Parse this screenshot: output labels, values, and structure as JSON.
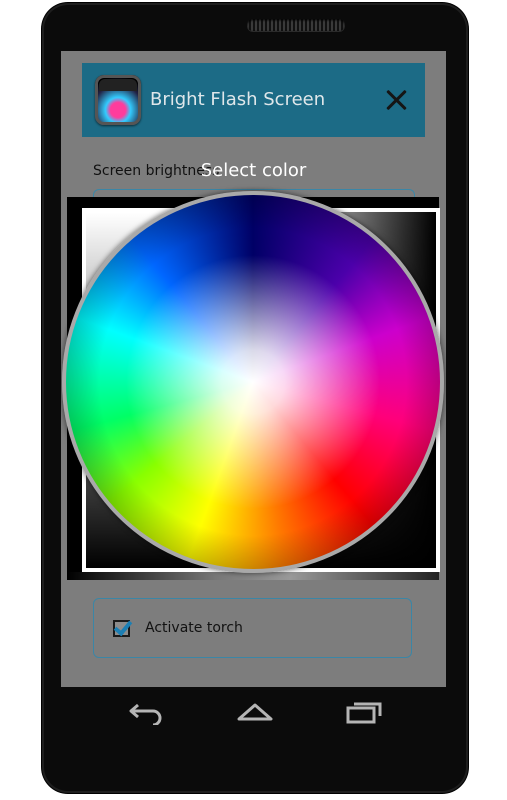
{
  "app": {
    "title": "Bright Flash Screen",
    "icon": "app-icon",
    "close_icon": "close-icon",
    "header_color": "#1c6b86"
  },
  "settings": {
    "brightness_label": "Screen brightness",
    "activate_torch_label": "Activate torch",
    "activate_torch_checked": true
  },
  "dialog": {
    "title": "Select color",
    "picker": {
      "square": "saturation-value-square",
      "wheel": "hue-color-wheel"
    }
  },
  "navbar": {
    "back_icon": "back-icon",
    "home_icon": "home-icon",
    "recent_icon": "recent-apps-icon"
  }
}
